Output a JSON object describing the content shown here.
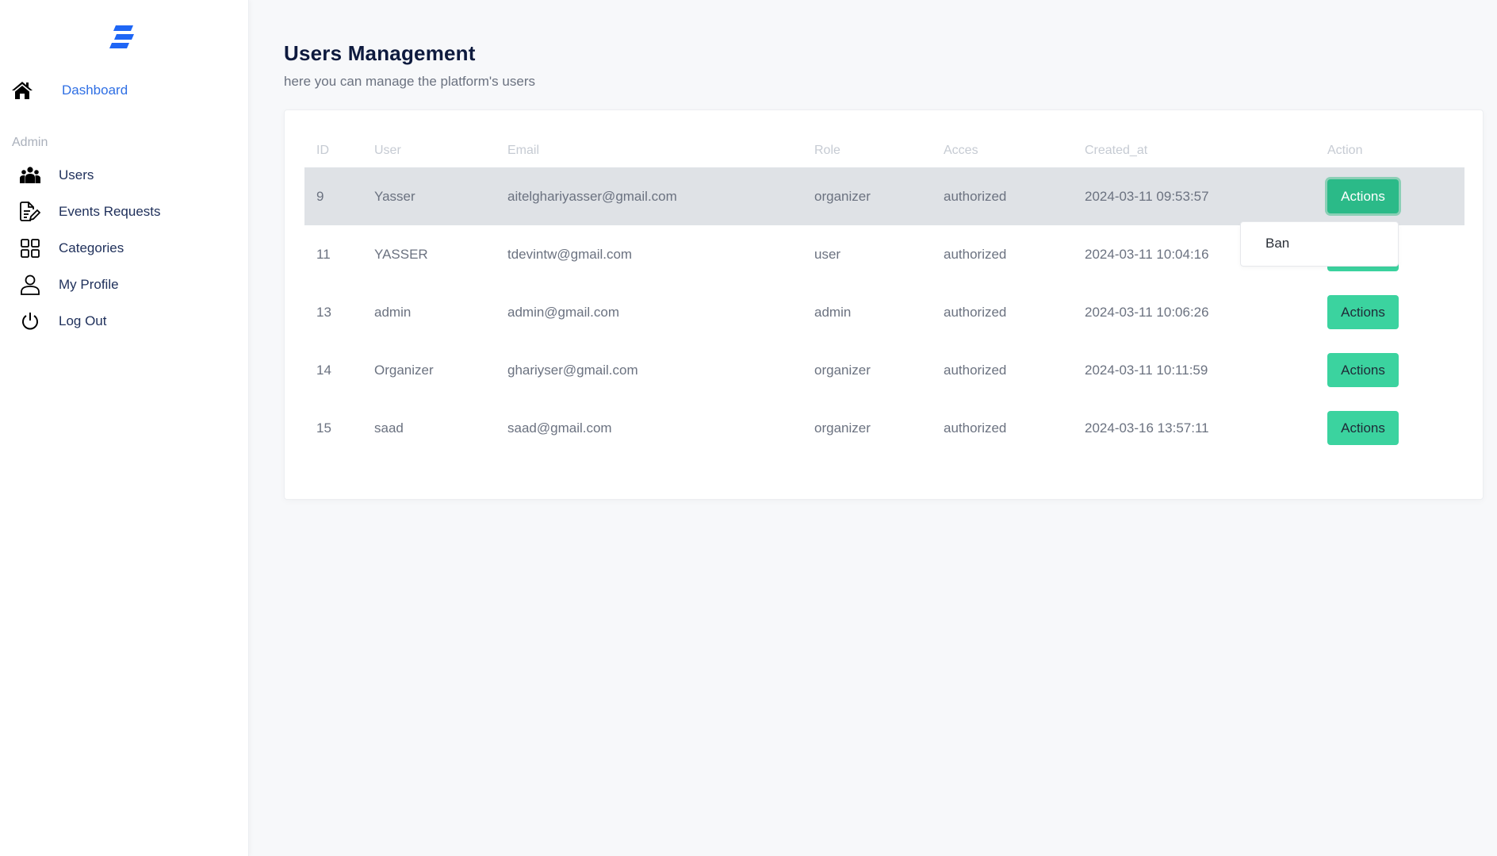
{
  "brand": {
    "logo_icon": "logo-stripes-icon",
    "accent_color": "#2f6fe4"
  },
  "sidebar": {
    "dashboard": {
      "label": "Dashboard",
      "icon": "home-icon"
    },
    "section_label": "Admin",
    "items": [
      {
        "label": "Users",
        "icon": "users-icon"
      },
      {
        "label": "Events Requests",
        "icon": "edit-document-icon"
      },
      {
        "label": "Categories",
        "icon": "grid-icon"
      },
      {
        "label": "My Profile",
        "icon": "user-icon"
      },
      {
        "label": "Log Out",
        "icon": "power-icon"
      }
    ]
  },
  "header": {
    "title": "Users Management",
    "subtitle": "here you can manage the platform's users"
  },
  "table": {
    "columns": [
      "ID",
      "User",
      "Email",
      "Role",
      "Acces",
      "Created_at",
      "Action"
    ],
    "rows": [
      {
        "id": "9",
        "user": "Yasser",
        "email": "aitelghariyasser@gmail.com",
        "role": "organizer",
        "access": "authorized",
        "created_at": "2024-03-11 09:53:57",
        "action_label": "Actions"
      },
      {
        "id": "11",
        "user": "YASSER",
        "email": "tdevintw@gmail.com",
        "role": "user",
        "access": "authorized",
        "created_at": "2024-03-11 10:04:16",
        "action_label": "Actions"
      },
      {
        "id": "13",
        "user": "admin",
        "email": "admin@gmail.com",
        "role": "admin",
        "access": "authorized",
        "created_at": "2024-03-11 10:06:26",
        "action_label": "Actions"
      },
      {
        "id": "14",
        "user": "Organizer",
        "email": "ghariyser@gmail.com",
        "role": "organizer",
        "access": "authorized",
        "created_at": "2024-03-11 10:11:59",
        "action_label": "Actions"
      },
      {
        "id": "15",
        "user": "saad",
        "email": "saad@gmail.com",
        "role": "organizer",
        "access": "authorized",
        "created_at": "2024-03-16 13:57:11",
        "action_label": "Actions"
      }
    ],
    "action_button_color": "#3bd39f"
  },
  "dropdown": {
    "items": [
      {
        "label": "Ban"
      }
    ]
  }
}
